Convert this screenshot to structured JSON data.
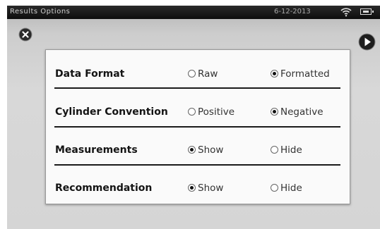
{
  "status_bar": {
    "title": "Results Options",
    "date": "6-12-2013"
  },
  "icons": {
    "close": "close-icon",
    "next": "next-arrow-icon",
    "wifi": "wifi-icon",
    "battery": "battery-icon"
  },
  "options": [
    {
      "label": "Data Format",
      "choices": [
        {
          "label": "Raw",
          "selected": false
        },
        {
          "label": "Formatted",
          "selected": true
        }
      ]
    },
    {
      "label": "Cylinder Convention",
      "choices": [
        {
          "label": "Positive",
          "selected": false
        },
        {
          "label": "Negative",
          "selected": true
        }
      ]
    },
    {
      "label": "Measurements",
      "choices": [
        {
          "label": "Show",
          "selected": true
        },
        {
          "label": "Hide",
          "selected": false
        }
      ]
    },
    {
      "label": "Recommendation",
      "choices": [
        {
          "label": "Show",
          "selected": true
        },
        {
          "label": "Hide",
          "selected": false
        }
      ]
    }
  ]
}
